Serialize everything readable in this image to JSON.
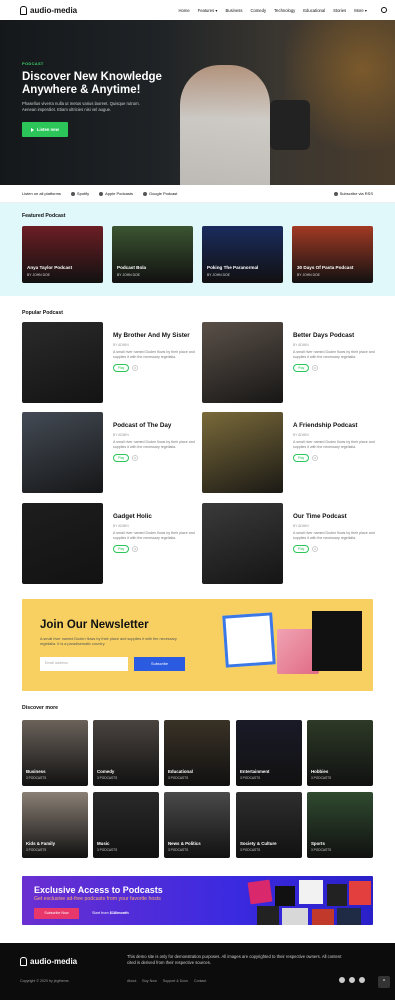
{
  "brand": {
    "name": "audio-media"
  },
  "nav": {
    "items": [
      "Home",
      "Features",
      "Business",
      "Comedy",
      "Technology",
      "Educational",
      "Stories",
      "More"
    ]
  },
  "hero": {
    "tag": "PODCAST",
    "title_line1": "Discover New Knowledge",
    "title_line2": "Anywhere & Anytime!",
    "subtitle_line1": "Phasellus viverra nulla ut metus varius laoreet. Quisque rutrum.",
    "subtitle_line2": "Aenean imperdiet. Etiam ultricies nisi vel augue.",
    "button": "Listen now"
  },
  "availability": {
    "label": "Listen on all platforms",
    "platforms": [
      "Spotify",
      "Apple Podcasts",
      "Google Podcast"
    ],
    "subscribe": "Subscribe via RSS"
  },
  "featured": {
    "title": "Featured Podcast",
    "cards": [
      {
        "title": "Anya Taylor Podcast",
        "by": "BY JOHN DOE",
        "bg": "#6b1e24"
      },
      {
        "title": "Podcast Bola",
        "by": "BY JOHN DOE",
        "bg": "#3b5531"
      },
      {
        "title": "Poking The Paranormal",
        "by": "BY JOHN DOE",
        "bg": "#1a2b5e"
      },
      {
        "title": "30 Days Of Pasta Podcast",
        "by": "BY JOHN DOE",
        "bg": "#a23a24"
      }
    ]
  },
  "popular": {
    "title": "Popular Podcast",
    "items": [
      {
        "title": "My Brother And My Sister",
        "by": "BY ADMIN",
        "desc": "A small river named Duden flows by their place and supplies it with the necessary regelialia.",
        "play": "Play",
        "count": "0",
        "bg": "#2a2a2a"
      },
      {
        "title": "Better Days Podcast",
        "by": "BY ADMIN",
        "desc": "A small river named Duden flows by their place and supplies it with the necessary regelialia.",
        "play": "Play",
        "count": "0",
        "bg": "#5a5048"
      },
      {
        "title": "Podcast of The Day",
        "by": "BY ADMIN",
        "desc": "A small river named Duden flows by their place and supplies it with the necessary regelialia.",
        "play": "Play",
        "count": "0",
        "bg": "#444b55"
      },
      {
        "title": "A Friendship Podcast",
        "by": "BY ADMIN",
        "desc": "A small river named Duden flows by their place and supplies it with the necessary regelialia.",
        "play": "Play",
        "count": "0",
        "bg": "#7a6a3a"
      },
      {
        "title": "Gadget Holic",
        "by": "BY ADMIN",
        "desc": "A small river named Duden flows by their place and supplies it with the necessary regelialia.",
        "play": "Play",
        "count": "0",
        "bg": "#1e1e1e"
      },
      {
        "title": "Our Time Podcast",
        "by": "BY ADMIN",
        "desc": "A small river named Duden flows by their place and supplies it with the necessary regelialia.",
        "play": "Play",
        "count": "0",
        "bg": "#3a3a3a"
      }
    ]
  },
  "newsletter": {
    "title": "Join Our Newsletter",
    "desc": "A small river named Duden flows by their place and supplies it with the necessary regelialia. It is a paradisematic country.",
    "placeholder": "Email address",
    "button": "Subscribe"
  },
  "discover": {
    "title": "Discover more",
    "items": [
      {
        "label": "Business",
        "count": "3 PODCASTS",
        "bg": "#6b625a"
      },
      {
        "label": "Comedy",
        "count": "3 PODCASTS",
        "bg": "#4a4440"
      },
      {
        "label": "Educational",
        "count": "3 PODCASTS",
        "bg": "#3a3226"
      },
      {
        "label": "Entertainment",
        "count": "3 PODCASTS",
        "bg": "#1a1a28"
      },
      {
        "label": "Hobbies",
        "count": "3 PODCASTS",
        "bg": "#2d3a26"
      },
      {
        "label": "Kids & Family",
        "count": "3 PODCASTS",
        "bg": "#8a8075"
      },
      {
        "label": "Music",
        "count": "3 PODCASTS",
        "bg": "#2a2a2a"
      },
      {
        "label": "News & Politics",
        "count": "3 PODCASTS",
        "bg": "#4a4a4a"
      },
      {
        "label": "Society & Culture",
        "count": "3 PODCASTS",
        "bg": "#2e2e2e"
      },
      {
        "label": "Sports",
        "count": "3 PODCASTS",
        "bg": "#2f4a2f"
      }
    ]
  },
  "promo": {
    "title": "Exclusive Access to Podcasts",
    "subtitle": "Get exclusive ad-free podcasts from your favorite hosts",
    "button": "Subscribe Now",
    "start_prefix": "Start from",
    "price": "$18/month"
  },
  "footer": {
    "copyright": "Copyright © 2020 by jegtheme.",
    "note": "This demo site is only for demonstration purposes. All images are copyrighted to their respective owners. All content cited is derived from their respective sources.",
    "links": [
      "About",
      "Buy Now",
      "Support & Docs",
      "Contact"
    ]
  }
}
